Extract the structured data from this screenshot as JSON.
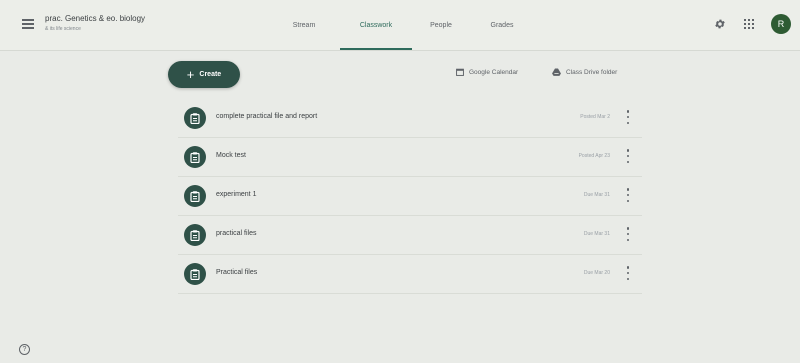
{
  "header": {
    "class_name": "prac. Genetics & eo. biology",
    "class_section": "& its life science",
    "avatar_initial": "R"
  },
  "tabs": [
    {
      "label": "Stream",
      "active": false
    },
    {
      "label": "Classwork",
      "active": true
    },
    {
      "label": "People",
      "active": false
    },
    {
      "label": "Grades",
      "active": false
    }
  ],
  "toolbar": {
    "create_label": "Create",
    "calendar_label": "Google Calendar",
    "drive_label": "Class Drive folder"
  },
  "items": [
    {
      "title": "complete practical file and report",
      "date": "Posted Mar 2",
      "icon": "assignment-icon"
    },
    {
      "title": "Mock test",
      "date": "Posted Apr 23",
      "icon": "assignment-icon"
    },
    {
      "title": "experiment 1",
      "date": "Due Mar 31",
      "icon": "assignment-icon"
    },
    {
      "title": "practical files",
      "date": "Due Mar 31",
      "icon": "assignment-icon"
    },
    {
      "title": "Practical files",
      "date": "Due Mar 20",
      "icon": "assignment-icon"
    }
  ],
  "colors": {
    "accent": "#2f5148",
    "active_tab": "#2f6b5c",
    "avatar": "#2e5b33",
    "background": "#e9ebe7"
  }
}
